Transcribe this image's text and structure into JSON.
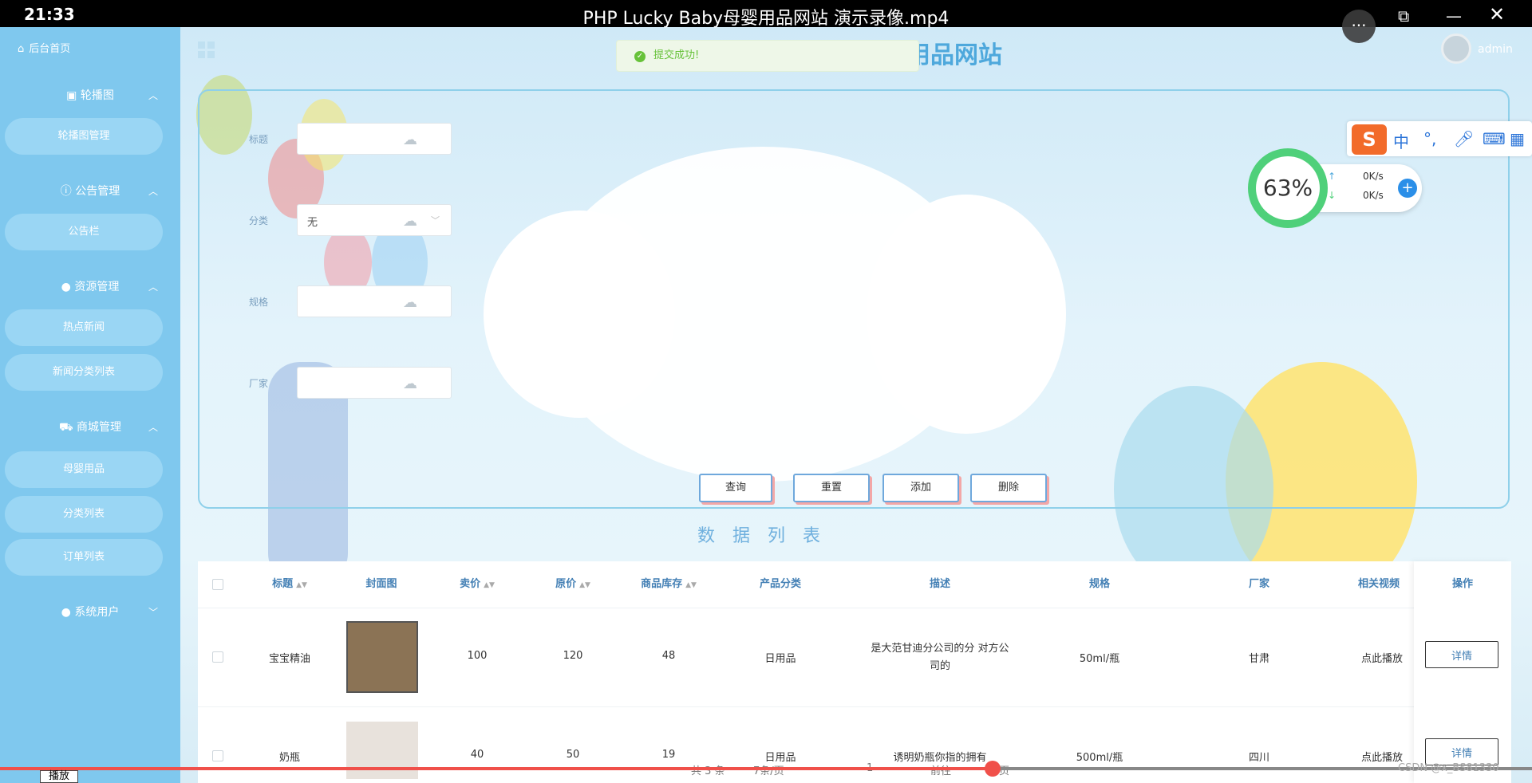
{
  "video": {
    "time": "21:33",
    "title": "PHP Lucky Baby母婴用品网站 演示录像.mp4",
    "play_label": "播放",
    "watermark": "CSDN @x_BS81330",
    "progress": 0.648
  },
  "sidebar": {
    "home": "后台首页",
    "groups": {
      "banner": "轮播图",
      "notice": "公告管理",
      "resource": "资源管理",
      "shop": "商城管理",
      "sysuser": "系统用户"
    },
    "items": {
      "banner_manage": "轮播图管理",
      "notice_bar": "公告栏",
      "hot_news": "热点新闻",
      "news_category": "新闻分类列表",
      "baby_products": "母婴用品",
      "category_list": "分类列表",
      "order_list": "订单列表"
    }
  },
  "header": {
    "site_title": "婴用品网站",
    "username": "admin"
  },
  "toast": "提交成功!",
  "form": {
    "title_label": "标题",
    "category_label": "分类",
    "category_value": "无",
    "spec_label": "规格",
    "maker_label": "厂家",
    "buttons": {
      "query": "查询",
      "reset": "重置",
      "add": "添加",
      "delete": "删除"
    }
  },
  "section_title": "数据列表",
  "table": {
    "headers": {
      "title": "标题",
      "cover": "封面图",
      "price": "卖价",
      "orig_price": "原价",
      "stock": "商品库存",
      "category": "产品分类",
      "desc": "描述",
      "spec": "规格",
      "maker": "厂家",
      "video": "相关视频",
      "op": "操作"
    },
    "rows": [
      {
        "title": "宝宝精油",
        "price": "100",
        "orig_price": "120",
        "stock": "48",
        "category": "日用品",
        "desc": "是大范甘迪分公司的分 对方公司的",
        "spec": "50ml/瓶",
        "maker": "甘肃",
        "video": "点此播放",
        "detail": "详情"
      },
      {
        "title": "奶瓶",
        "price": "40",
        "orig_price": "50",
        "stock": "19",
        "category": "日用品",
        "desc": "诱明奶瓶你指的拥有",
        "spec": "500ml/瓶",
        "maker": "四川",
        "video": "点此播放",
        "detail": "详情"
      }
    ]
  },
  "pager": {
    "total": "共 3 条",
    "size": "7条/页",
    "goto": "前往",
    "page": "1",
    "suffix": "页"
  },
  "net_monitor": {
    "percent": "63%",
    "up": "0K/s",
    "down": "0K/s"
  },
  "ime": {
    "lang": "中",
    "punct": "°,"
  },
  "colors": {
    "sidebar": "#7fc8ee",
    "accent": "#4480b5",
    "progress": "#f0504a",
    "success": "#67c23a"
  }
}
